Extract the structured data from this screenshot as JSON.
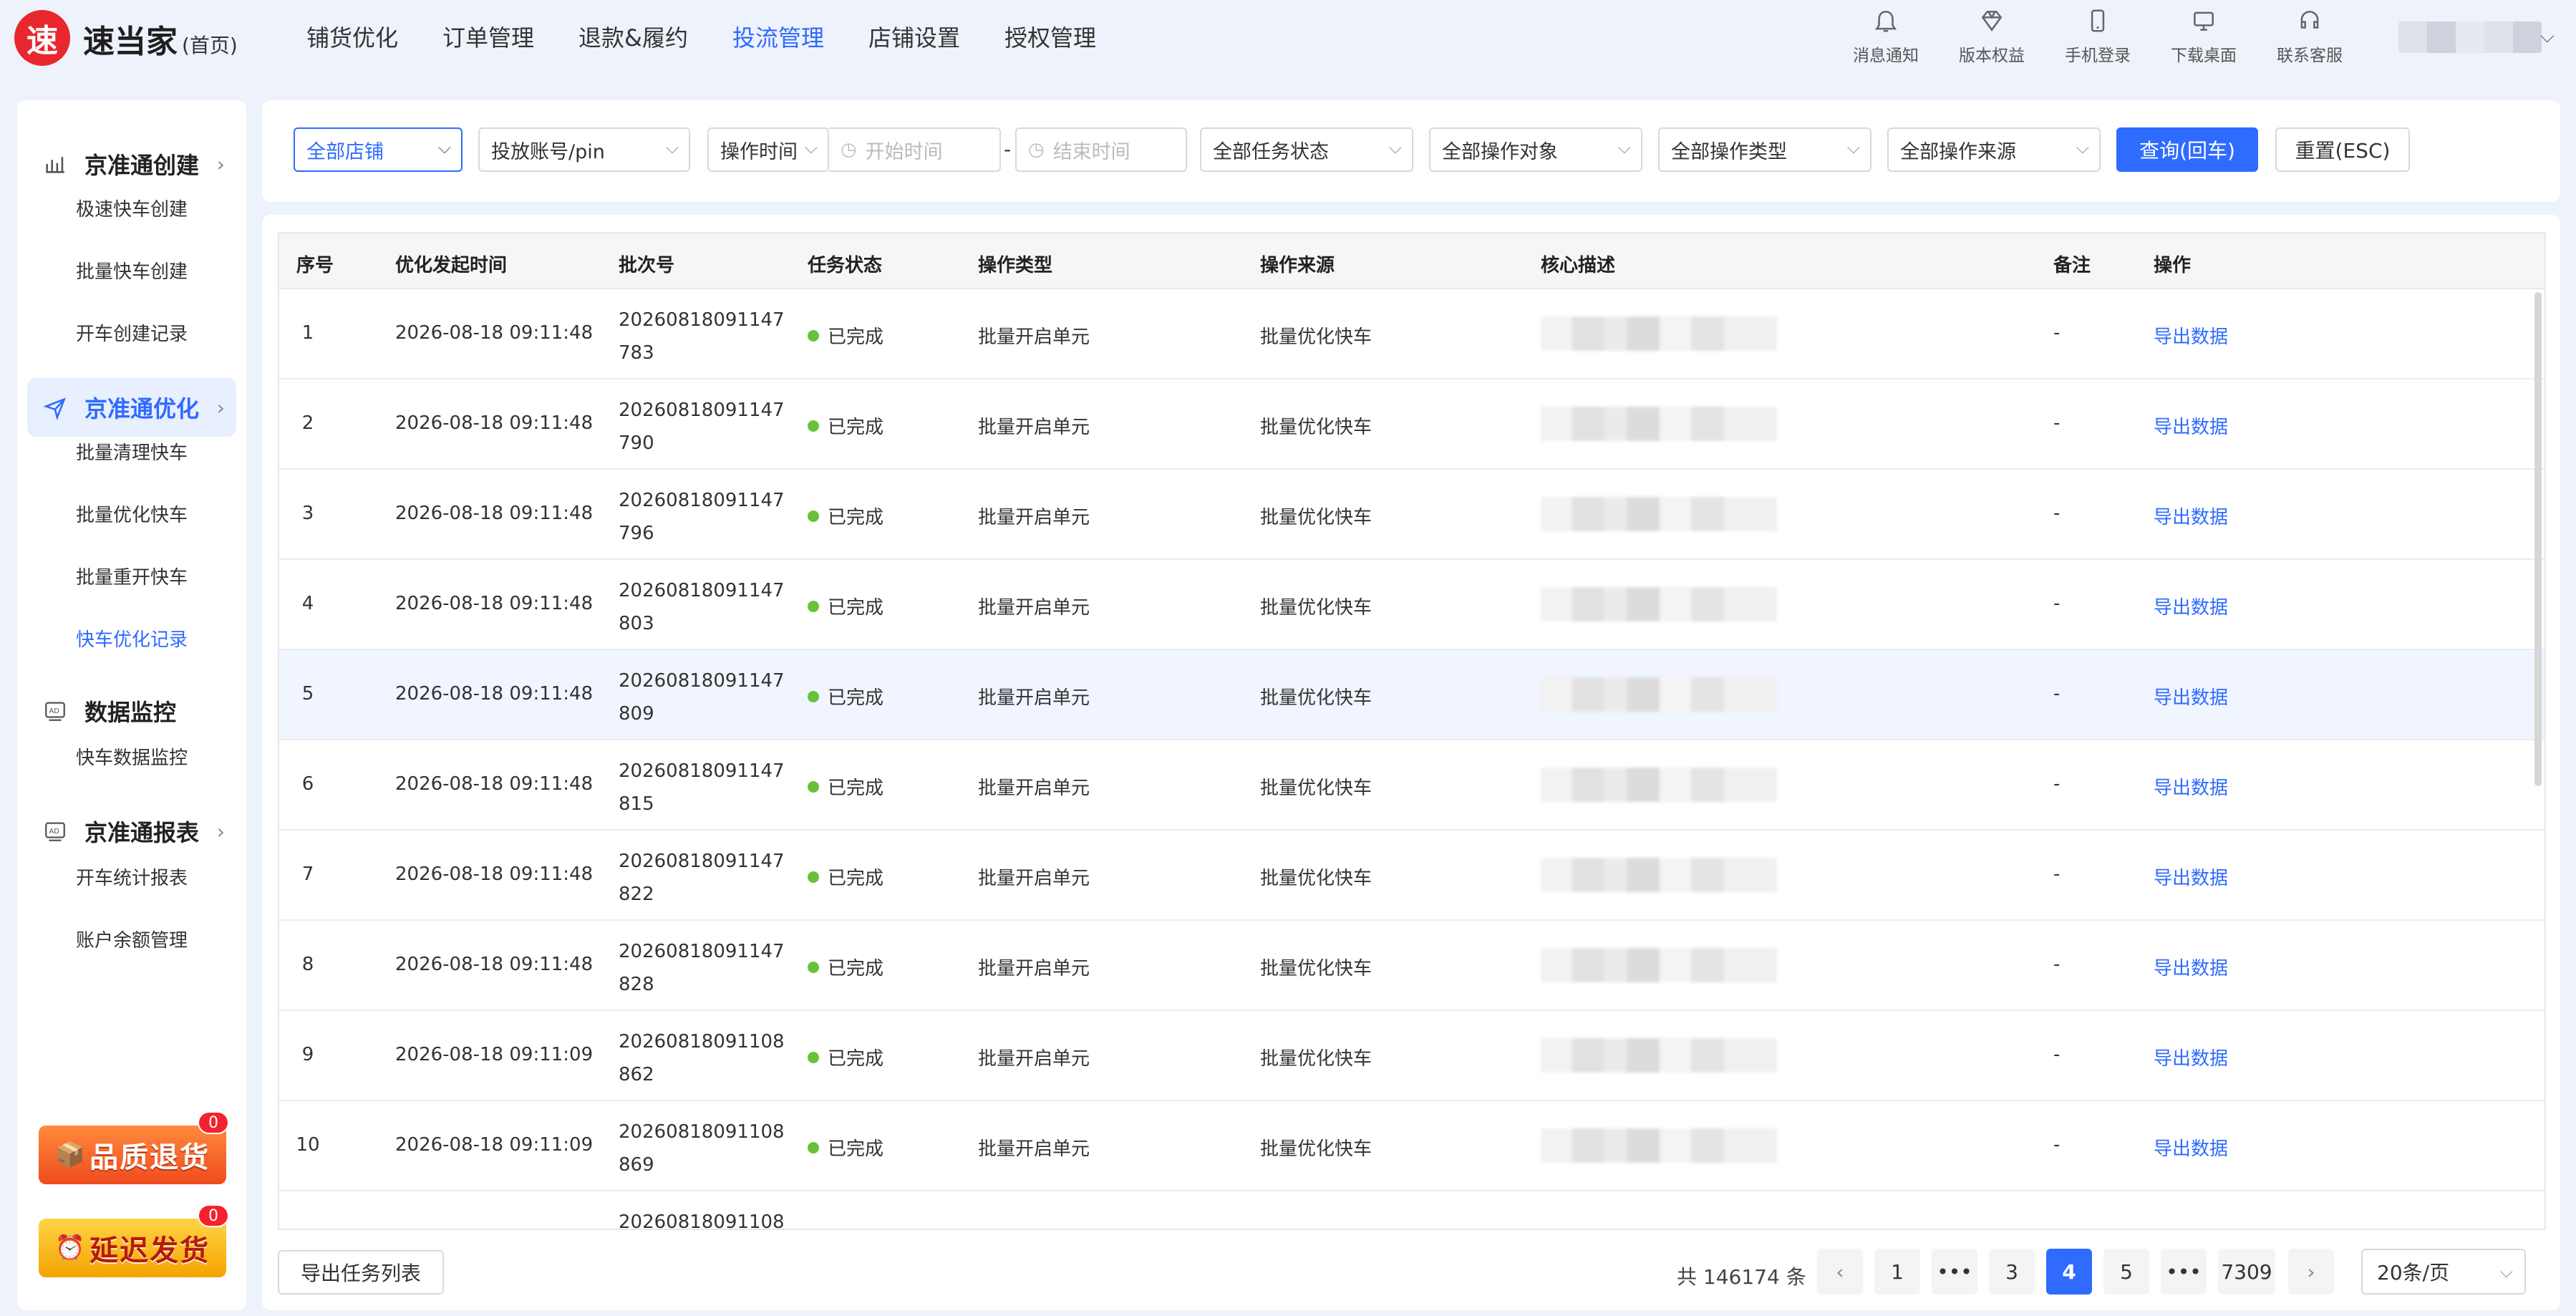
{
  "app": {
    "logo_char": "速",
    "name": "速当家",
    "home_label": "(首页)"
  },
  "nav": [
    "铺货优化",
    "订单管理",
    "退款&履约",
    "投流管理",
    "店铺设置",
    "授权管理"
  ],
  "nav_active_index": 3,
  "tools": [
    {
      "label": "消息通知",
      "icon": "bell-icon"
    },
    {
      "label": "版本权益",
      "icon": "diamond-icon"
    },
    {
      "label": "手机登录",
      "icon": "phone-icon"
    },
    {
      "label": "下载桌面",
      "icon": "monitor-icon"
    },
    {
      "label": "联系客服",
      "icon": "headset-icon"
    }
  ],
  "sidebar": {
    "groups": [
      {
        "label": "京准通创建",
        "icon": "bar-chart-icon",
        "arrow": "›",
        "items": [
          "极速快车创建",
          "批量快车创建",
          "开车创建记录"
        ]
      },
      {
        "label": "京准通优化",
        "icon": "send-icon",
        "arrow": "›",
        "items": [
          "批量清理快车",
          "批量优化快车",
          "批量重开快车",
          "快车优化记录"
        ]
      },
      {
        "label": "数据监控",
        "icon": "ad-icon",
        "arrow": "",
        "items": [
          "快车数据监控"
        ]
      },
      {
        "label": "京准通报表",
        "icon": "ad-icon",
        "arrow": "›",
        "items": [
          "开车统计报表",
          "账户余额管理"
        ]
      }
    ],
    "active_group": "京准通优化",
    "active_item": "快车优化记录",
    "promos": [
      {
        "label": "品质退货",
        "badge": "0",
        "icon": "box-icon"
      },
      {
        "label": "延迟发货",
        "badge": "0",
        "icon": "clock-icon"
      }
    ]
  },
  "filters": {
    "shop": "全部店铺",
    "account": "投放账号/pin",
    "op_time": "操作时间",
    "start_time": "开始时间",
    "end_time": "结束时间",
    "task_status": "全部任务状态",
    "op_target": "全部操作对象",
    "op_type": "全部操作类型",
    "op_source": "全部操作来源",
    "query_button": "查询(回车)",
    "reset_button": "重置(ESC)"
  },
  "table": {
    "columns": [
      "序号",
      "优化发起时间",
      "批次号",
      "任务状态",
      "操作类型",
      "操作来源",
      "核心描述",
      "备注",
      "操作"
    ],
    "rows": [
      {
        "idx": "1",
        "time": "2026-08-18 09:11:48",
        "batch": "20260818091147783",
        "status": "已完成",
        "type": "批量开启单元",
        "source": "批量优化快车",
        "note": "-",
        "action": "导出数据"
      },
      {
        "idx": "2",
        "time": "2026-08-18 09:11:48",
        "batch": "20260818091147790",
        "status": "已完成",
        "type": "批量开启单元",
        "source": "批量优化快车",
        "note": "-",
        "action": "导出数据"
      },
      {
        "idx": "3",
        "time": "2026-08-18 09:11:48",
        "batch": "20260818091147796",
        "status": "已完成",
        "type": "批量开启单元",
        "source": "批量优化快车",
        "note": "-",
        "action": "导出数据"
      },
      {
        "idx": "4",
        "time": "2026-08-18 09:11:48",
        "batch": "20260818091147803",
        "status": "已完成",
        "type": "批量开启单元",
        "source": "批量优化快车",
        "note": "-",
        "action": "导出数据"
      },
      {
        "idx": "5",
        "time": "2026-08-18 09:11:48",
        "batch": "20260818091147809",
        "status": "已完成",
        "type": "批量开启单元",
        "source": "批量优化快车",
        "note": "-",
        "action": "导出数据"
      },
      {
        "idx": "6",
        "time": "2026-08-18 09:11:48",
        "batch": "20260818091147815",
        "status": "已完成",
        "type": "批量开启单元",
        "source": "批量优化快车",
        "note": "-",
        "action": "导出数据"
      },
      {
        "idx": "7",
        "time": "2026-08-18 09:11:48",
        "batch": "20260818091147822",
        "status": "已完成",
        "type": "批量开启单元",
        "source": "批量优化快车",
        "note": "-",
        "action": "导出数据"
      },
      {
        "idx": "8",
        "time": "2026-08-18 09:11:48",
        "batch": "20260818091147828",
        "status": "已完成",
        "type": "批量开启单元",
        "source": "批量优化快车",
        "note": "-",
        "action": "导出数据"
      },
      {
        "idx": "9",
        "time": "2026-08-18 09:11:09",
        "batch": "20260818091108862",
        "status": "已完成",
        "type": "批量开启单元",
        "source": "批量优化快车",
        "note": "-",
        "action": "导出数据"
      },
      {
        "idx": "10",
        "time": "2026-08-18 09:11:09",
        "batch": "20260818091108869",
        "status": "已完成",
        "type": "批量开启单元",
        "source": "批量优化快车",
        "note": "-",
        "action": "导出数据"
      },
      {
        "idx": "",
        "time": "",
        "batch": "20260818091108",
        "status": "",
        "type": "",
        "source": "",
        "note": "",
        "action": ""
      }
    ],
    "highlighted_row_index": 4,
    "status_color": "#67c23a"
  },
  "footer": {
    "export_list": "导出任务列表",
    "total": "共 146174 条",
    "pages": [
      "1",
      "•••",
      "3",
      "4",
      "5",
      "•••",
      "7309"
    ],
    "current_page": "4",
    "prev": "‹",
    "next": "›",
    "page_size": "20条/页"
  },
  "colors": {
    "accent": "#2f6bff",
    "logo": "#e8272f",
    "background": "#eef2fb"
  }
}
